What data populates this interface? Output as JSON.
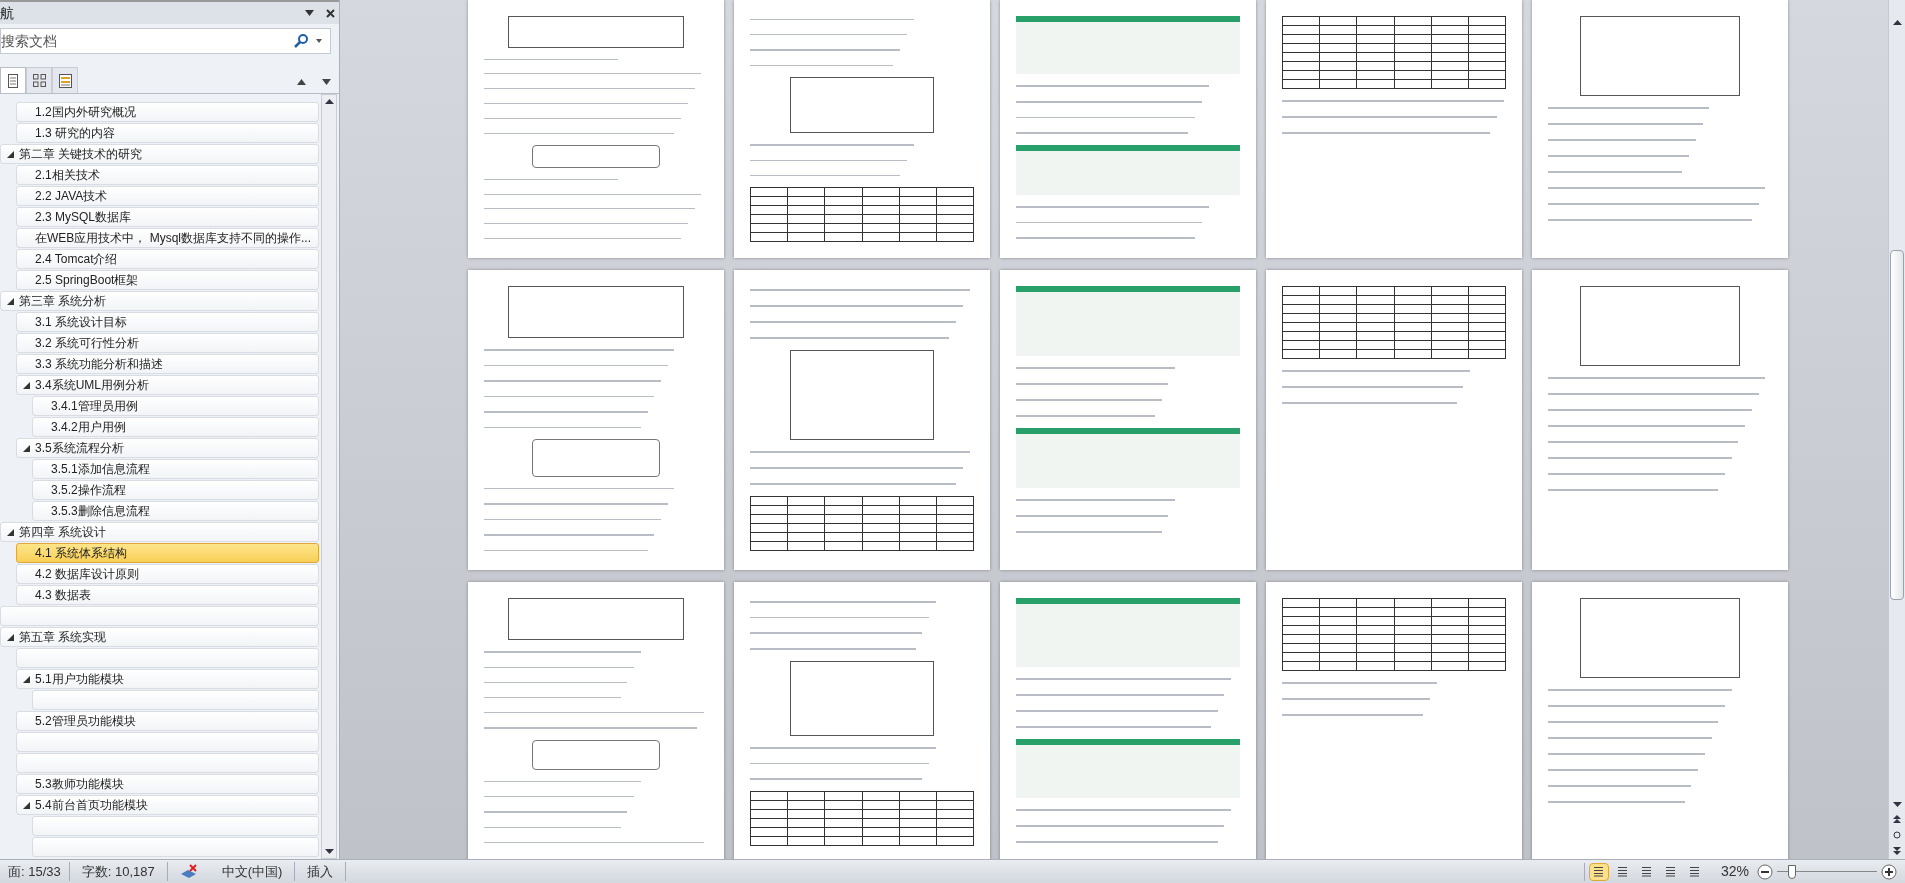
{
  "nav_pane": {
    "title": "航",
    "search": {
      "placeholder": "搜索文档"
    },
    "view_tabs": [
      {
        "selected": true
      },
      {
        "selected": false
      },
      {
        "selected": false
      }
    ],
    "tree": [
      {
        "children": [
          {
            "label": "1.2国内外研究概况",
            "selected": false
          },
          {
            "label": "1.3 研究的内容",
            "selected": false
          }
        ]
      },
      {
        "label": "第二章 关键技术的研究",
        "selected": false,
        "expanded": true,
        "children": [
          {
            "label": "2.1相关技术",
            "selected": false
          },
          {
            "label": "2.2 JAVA技术",
            "selected": false
          },
          {
            "label": "2.3 MySQL数据库",
            "selected": false
          },
          {
            "label": "在WEB应用技术中， Mysql数据库支持不同的操作...",
            "selected": false
          },
          {
            "label": "2.4 Tomcat介绍",
            "selected": false
          },
          {
            "label": "2.5 SpringBoot框架",
            "selected": false
          }
        ]
      },
      {
        "label": "第三章 系统分析",
        "selected": false,
        "expanded": true,
        "children": [
          {
            "label": "3.1 系统设计目标",
            "selected": false
          },
          {
            "label": "3.2 系统可行性分析",
            "selected": false
          },
          {
            "label": "3.3 系统功能分析和描述",
            "selected": false
          },
          {
            "label": "3.4系统UML用例分析",
            "selected": false,
            "expanded": true,
            "children": [
              {
                "label": "3.4.1管理员用例",
                "selected": false
              },
              {
                "label": "3.4.2用户用例",
                "selected": false
              }
            ]
          },
          {
            "label": "3.5系统流程分析",
            "selected": false,
            "expanded": true,
            "children": [
              {
                "label": "3.5.1添加信息流程",
                "selected": false
              },
              {
                "label": "3.5.2操作流程",
                "selected": false
              },
              {
                "label": "3.5.3删除信息流程",
                "selected": false
              }
            ]
          }
        ]
      },
      {
        "label": "第四章 系统设计",
        "selected": false,
        "expanded": true,
        "children": [
          {
            "label": "4.1 系统体系结构",
            "selected": true
          },
          {
            "label": "4.2 数据库设计原则",
            "selected": false
          },
          {
            "label": "4.3 数据表",
            "selected": false
          }
        ]
      },
      {
        "selected": false
      },
      {
        "label": "第五章 系统实现",
        "selected": false,
        "expanded": true,
        "children": [
          {
            "selected": false
          },
          {
            "label": "5.1用户功能模块",
            "selected": false,
            "expanded": true,
            "children": [
              {
                "selected": false
              }
            ]
          },
          {
            "label": "5.2管理员功能模块",
            "selected": false
          },
          {
            "selected": false
          },
          {
            "selected": false
          },
          {
            "label": "5.3教师功能模块",
            "selected": false
          },
          {
            "label": "5.4前台首页功能模块",
            "selected": false,
            "expanded": true,
            "children": [
              {
                "selected": false
              },
              {
                "selected": false
              }
            ]
          }
        ]
      }
    ]
  },
  "status_bar": {
    "page": "面: 15/33",
    "words": "字数: 10,187",
    "language": "中文(中国)",
    "mode": "插入",
    "views": [
      {
        "selected": true
      },
      {
        "selected": false
      },
      {
        "selected": false
      },
      {
        "selected": false
      },
      {
        "selected": false
      }
    ],
    "zoom": "32%",
    "zoom_slider": {
      "level": 0.15
    }
  }
}
